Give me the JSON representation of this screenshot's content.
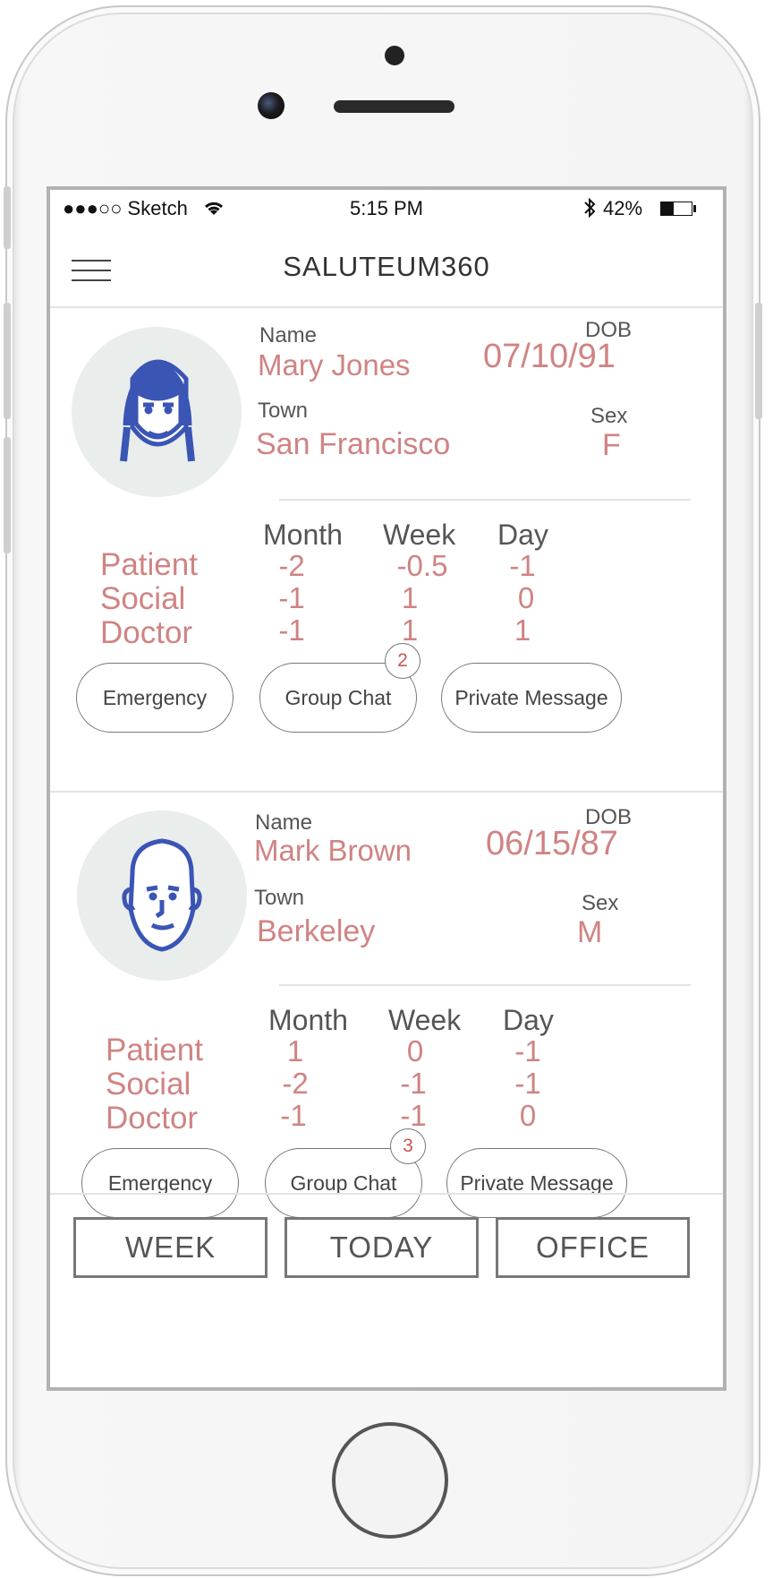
{
  "status_bar": {
    "carrier": "●●●○○ Sketch",
    "time": "5:15 PM",
    "battery_pct": "42%",
    "battery_level": 0.42
  },
  "header": {
    "title": "SALUTEUM360"
  },
  "labels": {
    "name": "Name",
    "dob": "DOB",
    "town": "Town",
    "sex": "Sex"
  },
  "table_headers": [
    "Month",
    "Week",
    "Day"
  ],
  "row_labels": [
    "Patient",
    "Social",
    "Doctor"
  ],
  "patients": [
    {
      "name": "Mary Jones",
      "dob": "07/10/91",
      "town": "San Francisco",
      "sex": "F",
      "avatar_icon": "female-avatar-icon",
      "rows": [
        [
          "-2",
          "-0.5",
          "-1"
        ],
        [
          "-1",
          "1",
          "0"
        ],
        [
          "-1",
          "1",
          "1"
        ]
      ],
      "actions": {
        "emergency": "Emergency",
        "group_chat": "Group Chat",
        "group_chat_badge": "2",
        "private_message": "Private Message"
      }
    },
    {
      "name": "Mark Brown",
      "dob": "06/15/87",
      "town": "Berkeley",
      "sex": "M",
      "avatar_icon": "male-avatar-icon",
      "rows": [
        [
          "1",
          "0",
          "-1"
        ],
        [
          "-2",
          "-1",
          "-1"
        ],
        [
          "-1",
          "-1",
          "0"
        ]
      ],
      "actions": {
        "emergency": "Emergency",
        "group_chat": "Group Chat",
        "group_chat_badge": "3",
        "private_message": "Private Message"
      }
    }
  ],
  "tabs": [
    "WEEK",
    "TODAY",
    "OFFICE"
  ],
  "colors": {
    "accent": "#d08383",
    "avatar_blue": "#3b55b5",
    "avatar_bg": "#e9eeec"
  }
}
